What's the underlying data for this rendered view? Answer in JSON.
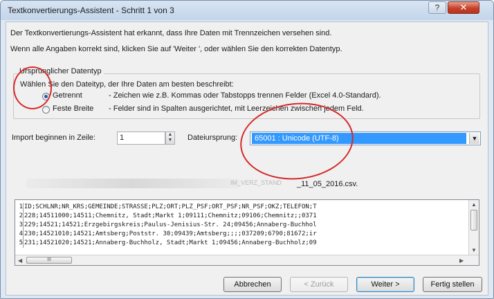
{
  "window": {
    "title": "Textkonvertierungs-Assistent - Schritt 1 von 3",
    "help_label": "?",
    "close_label": "✕"
  },
  "intro": {
    "line1": "Der Textkonvertierungs-Assistent hat erkannt, dass Ihre Daten mit Trennzeichen versehen sind.",
    "line2": "Wenn alle Angaben korrekt sind, klicken Sie auf 'Weiter ', oder wählen Sie den korrekten Datentyp."
  },
  "datatype_group": {
    "legend": "Ursprünglicher Datentyp",
    "prompt": "Wählen Sie den Dateityp, der Ihre Daten am besten beschreibt:",
    "options": [
      {
        "label": "Getrennt",
        "desc": "- Zeichen wie z.B. Kommas oder Tabstopps trennen Felder (Excel 4.0-Standard).",
        "selected": true
      },
      {
        "label": "Feste Breite",
        "desc": "- Felder sind in Spalten ausgerichtet, mit Leerzeichen zwischen jedem Feld.",
        "selected": false
      }
    ]
  },
  "import_row": {
    "start_label": "Import beginnen in Zeile:",
    "start_value": "1",
    "origin_label": "Dateiursprung:",
    "origin_value": "65001 : Unicode (UTF-8)"
  },
  "preview": {
    "filename_blurred": "IM_VERZ_STAND",
    "filename_visible": "_11_05_2016.csv.",
    "rows": [
      {
        "num": "1",
        "text": "ID;SCHLNR;NR_KRS;GEMEINDE;STRASSE;PLZ;ORT;PLZ_PSF;ORT_PSF;NR_PSF;OKZ;TELEFON;T"
      },
      {
        "num": "2",
        "text": "228;14511000;14511;Chemnitz, Stadt;Markt 1;09111;Chemnitz;09106;Chemnitz;;0371"
      },
      {
        "num": "3",
        "text": "229;14521;14521;Erzgebirgskreis;Paulus-Jenisius-Str. 24;09456;Annaberg-Buchhol"
      },
      {
        "num": "4",
        "text": "230;14521010;14521;Amtsberg;Poststr. 30;09439;Amtsberg;;;;037209;6790;81672;ir"
      },
      {
        "num": "5",
        "text": "231;14521020;14521;Annaberg-Buchholz, Stadt;Markt 1;09456;Annaberg-Buchholz;09"
      }
    ],
    "scroll_thumb_label": "III"
  },
  "buttons": {
    "cancel": "Abbrechen",
    "back": "< Zurück",
    "next": "Weiter >",
    "finish": "Fertig stellen"
  },
  "colors": {
    "annotation_ring": "#d42a2a",
    "selection": "#3399ff"
  }
}
